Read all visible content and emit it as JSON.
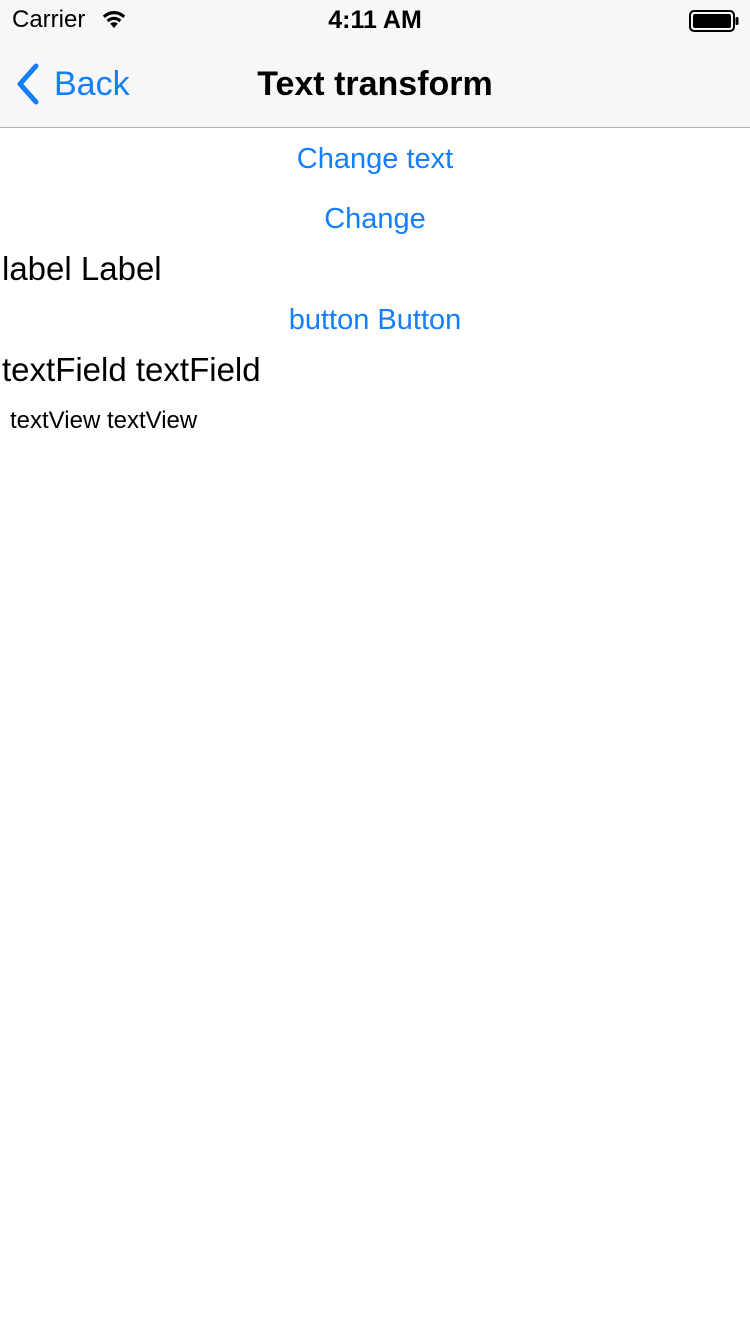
{
  "status_bar": {
    "carrier": "Carrier",
    "time": "4:11 AM",
    "wifi_icon": "wifi-icon",
    "battery_icon": "battery-full-icon"
  },
  "nav_bar": {
    "back_label": "Back",
    "back_icon": "chevron-left-icon",
    "title": "Text transform"
  },
  "content": {
    "change_text_button": "Change text",
    "change_button": "Change",
    "label_text": "label Label",
    "button_text": "button Button",
    "text_field_value": "textField textField",
    "text_view_text": "textView textView"
  },
  "colors": {
    "accent": "#147efb",
    "nav_background": "#f7f7f7",
    "nav_border": "#b2b2b2",
    "text": "#000000",
    "background": "#ffffff"
  }
}
